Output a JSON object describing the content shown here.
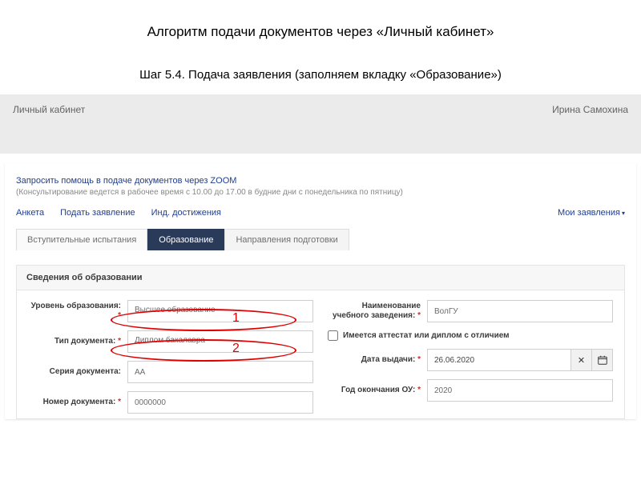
{
  "slide": {
    "title": "Алгоритм подачи документов через «Личный кабинет»",
    "subtitle": "Шаг 5.4. Подача заявления (заполняем вкладку «Образование»)"
  },
  "topbar": {
    "left": "Личный кабинет",
    "right": "Ирина Самохина"
  },
  "zoom": {
    "link": "Запросить помощь в подаче документов через ZOOM",
    "note": "(Консультирование ведется в рабочее время с 10.00 до 17.00 в будние дни с понедельника по пятницу)"
  },
  "mainTabs": {
    "anketa": "Анкета",
    "submit": "Подать заявление",
    "ind": "Инд. достижения",
    "my": "Мои заявления"
  },
  "subTabs": {
    "exams": "Вступительные испытания",
    "edu": "Образование",
    "dirs": "Направления подготовки"
  },
  "section": {
    "header": "Сведения об образовании"
  },
  "form": {
    "levelLabel": "Уровень образования:",
    "levelValue": "Высшее образование",
    "docTypeLabel": "Тип документа:",
    "docTypeValue": "Диплом бакалавра",
    "seriesLabel": "Серия документа:",
    "seriesValue": "АА",
    "numberLabel": "Номер документа:",
    "numberValue": "0000000",
    "schoolLabel": "Наименование учебного заведения:",
    "schoolValue": "ВолГУ",
    "honorsLabel": "Имеется аттестат или диплом с отличием",
    "dateLabel": "Дата выдачи:",
    "dateValue": "26.06.2020",
    "yearLabel": "Год окончания ОУ:",
    "yearValue": "2020"
  },
  "annotations": {
    "one": "1",
    "two": "2"
  }
}
